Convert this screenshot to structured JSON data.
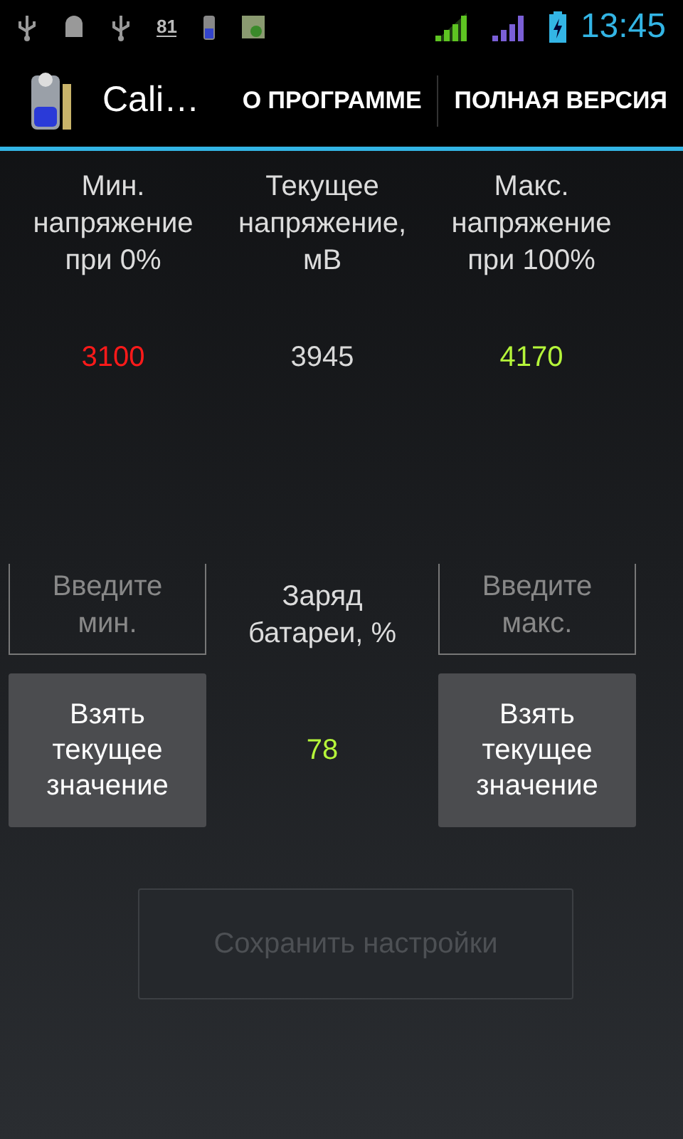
{
  "status_bar": {
    "notification_count": "81",
    "time": "13:45"
  },
  "action_bar": {
    "title": "Cali…",
    "actions": [
      {
        "label": "О ПРОГРАММЕ"
      },
      {
        "label": "ПОЛНАЯ ВЕРСИЯ"
      }
    ]
  },
  "columns": [
    {
      "heading": "Мин. напряжение при 0%",
      "value": "3100",
      "color": "#ff1a1a"
    },
    {
      "heading": "Текущее напряжение, мВ",
      "value": "3945",
      "color": "#d9d9d9"
    },
    {
      "heading": "Макс. напряжение при 100%",
      "value": "4170",
      "color": "#b5f53a"
    }
  ],
  "min_field": {
    "placeholder": "Введите мин."
  },
  "charge": {
    "label": "Заряд батареи, %",
    "value": "78"
  },
  "max_field": {
    "placeholder": "Введите макс."
  },
  "take_buttons": [
    {
      "label": "Взять текущее значение"
    },
    {
      "label": "Взять текущее значение"
    }
  ],
  "save_button": {
    "label": "Сохранить настройки",
    "disabled": true
  }
}
